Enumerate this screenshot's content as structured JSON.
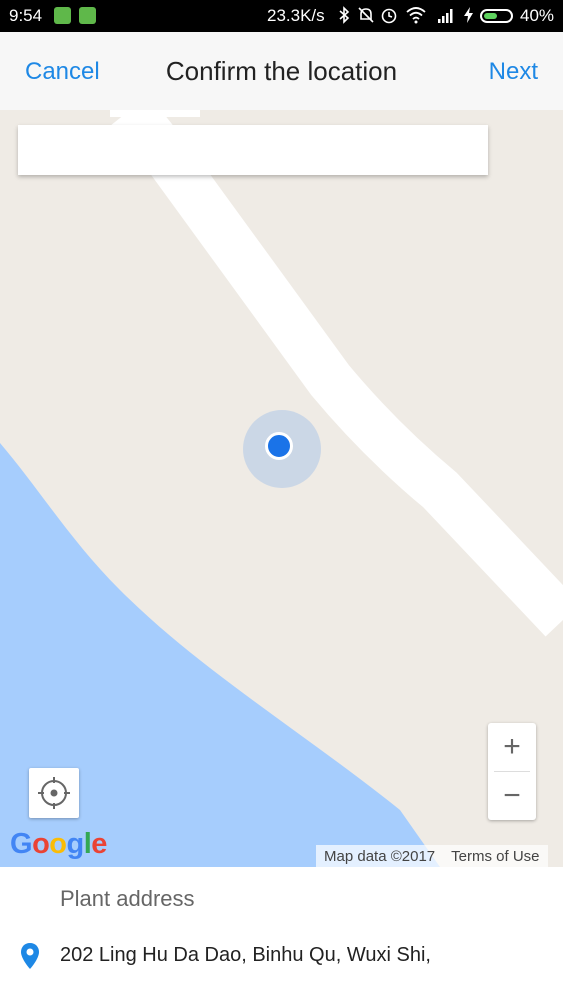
{
  "status_bar": {
    "time": "9:54",
    "network_speed": "23.3K/s",
    "battery_percent": "40%",
    "icons": [
      "app-notification-icon",
      "android-icon",
      "bluetooth-icon",
      "mute-icon",
      "alarm-icon",
      "wifi-icon",
      "signal-icon",
      "charging-icon",
      "battery-icon"
    ]
  },
  "nav": {
    "cancel_label": "Cancel",
    "title": "Confirm the location",
    "next_label": "Next"
  },
  "map": {
    "search_value": "",
    "zoom_in_label": "+",
    "zoom_out_label": "−",
    "google_logo": "Google",
    "map_data": "Map data ©2017",
    "terms": "Terms of Use",
    "colors": {
      "land": "#efebe5",
      "water": "#a6cdfd",
      "road": "#ffffff",
      "location": "#1a73e8"
    }
  },
  "address": {
    "label": "Plant address",
    "value": "202 Ling Hu Da Dao, Binhu Qu, Wuxi Shi,"
  },
  "colors": {
    "accent": "#1e88e5"
  }
}
